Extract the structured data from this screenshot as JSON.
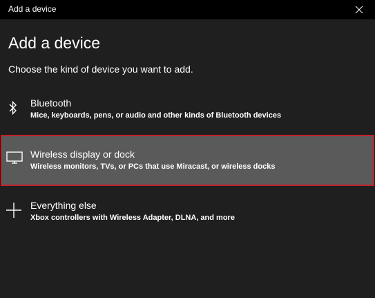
{
  "window": {
    "title": "Add a device"
  },
  "heading": "Add a device",
  "subheading": "Choose the kind of device you want to add.",
  "options": [
    {
      "title": "Bluetooth",
      "description": "Mice, keyboards, pens, or audio and other kinds of Bluetooth devices",
      "icon": "bluetooth-icon",
      "selected": false
    },
    {
      "title": "Wireless display or dock",
      "description": "Wireless monitors, TVs, or PCs that use Miracast, or wireless docks",
      "icon": "monitor-icon",
      "selected": true
    },
    {
      "title": "Everything else",
      "description": "Xbox controllers with Wireless Adapter, DLNA, and more",
      "icon": "plus-icon",
      "selected": false
    }
  ],
  "colors": {
    "background": "#1f1f1f",
    "titlebar": "#000000",
    "selected_background": "#5a5a5a",
    "selected_border": "#c4202a",
    "text": "#ffffff"
  }
}
